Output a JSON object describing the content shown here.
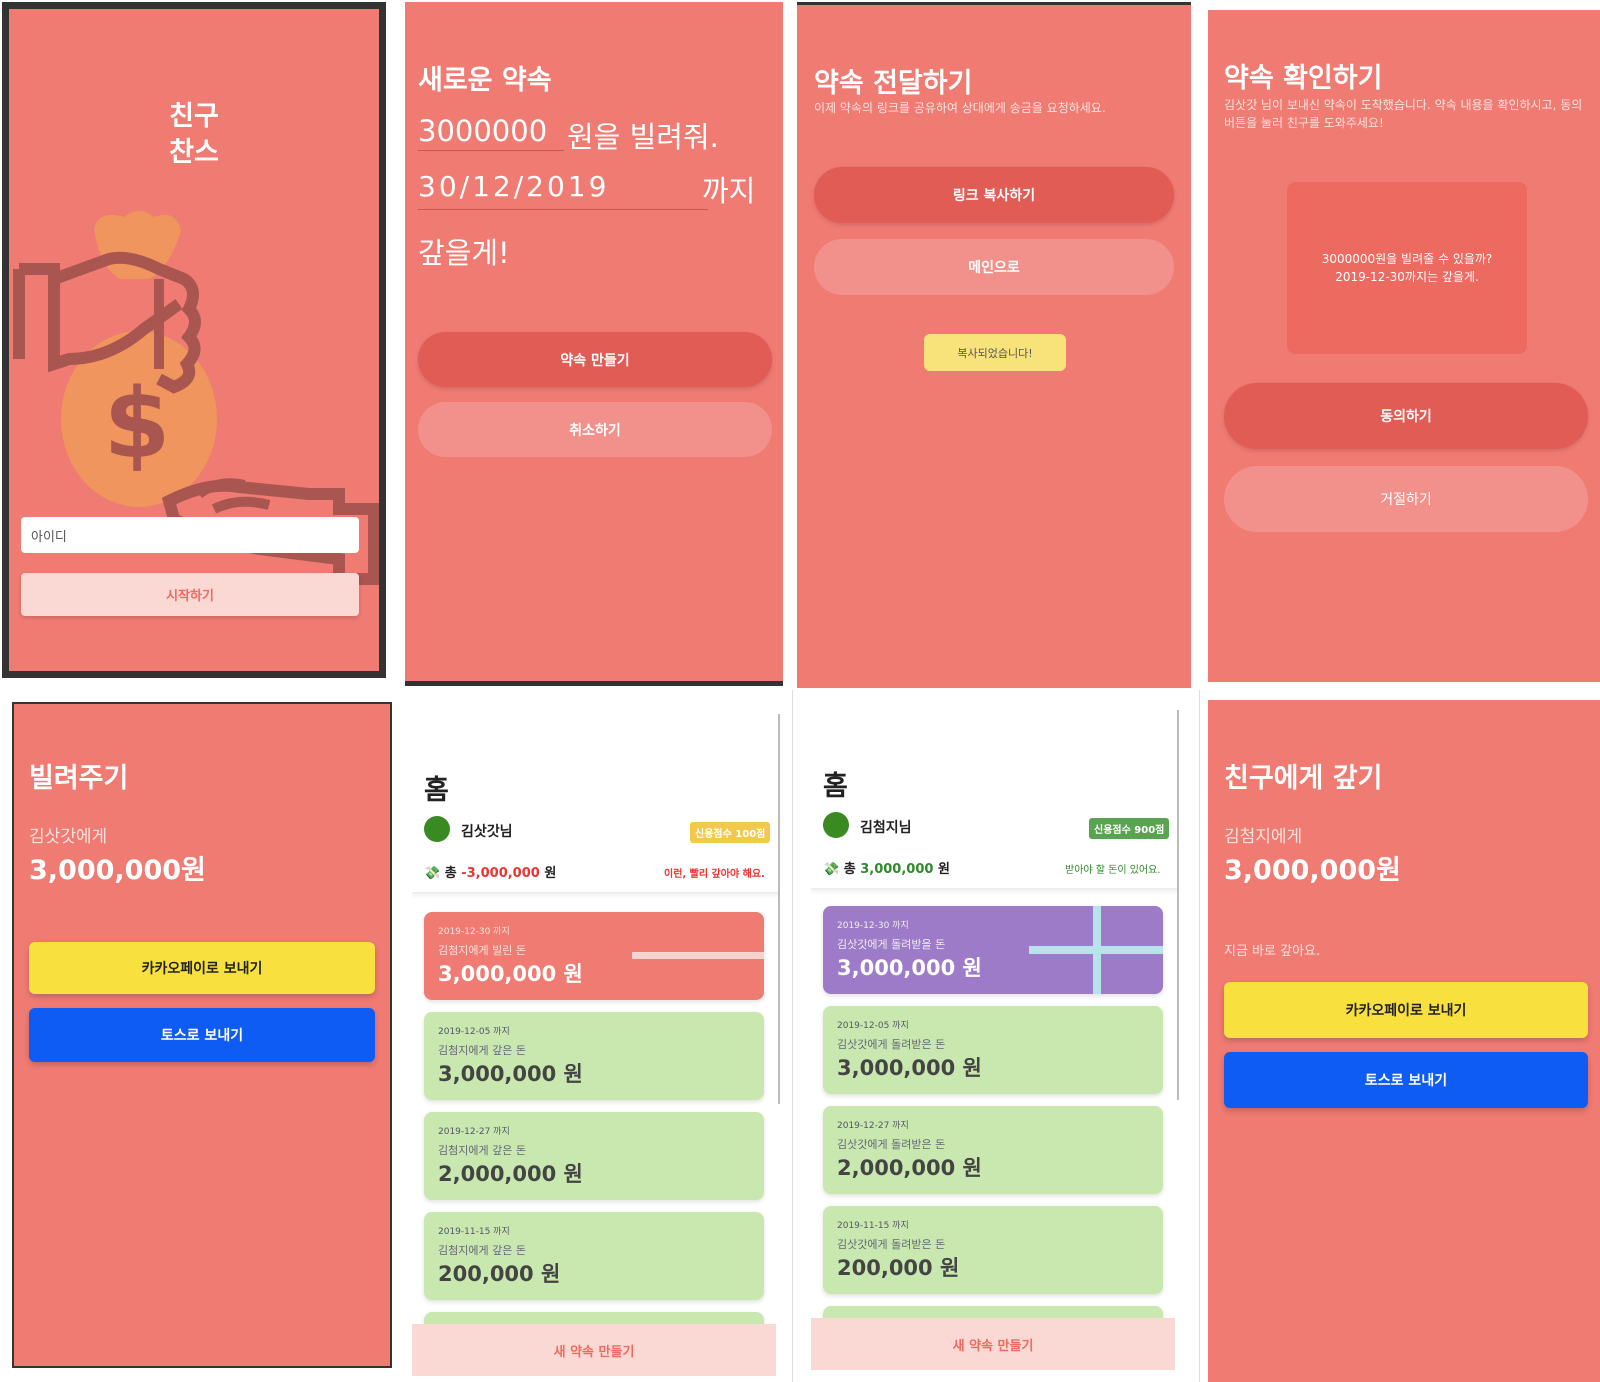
{
  "colors": {
    "coral": "#ef7b73",
    "primary_button": "#e05c55",
    "secondary_button": "#f2918b",
    "kakao": "#f8e13f",
    "toss": "#0f5cf5",
    "card_green": "#c8e8b0",
    "card_purple": "#9e7bc8"
  },
  "login": {
    "app_title_line1": "친구",
    "app_title_line2": "찬스",
    "illustration_icon": "money-bag-hand-icon",
    "id_placeholder": "아이디",
    "start_button": "시작하기"
  },
  "new_promise": {
    "title": "새로운 약속",
    "amount_value": "3000000",
    "amount_suffix": "원을 빌려줘.",
    "date_value": "30/12/2019",
    "date_suffix": "까지",
    "repay_text": "갚을게!",
    "make_button": "약속 만들기",
    "cancel_button": "취소하기"
  },
  "deliver": {
    "title": "약속 전달하기",
    "subtitle": "이제 약속의 링크를 공유하여 상대에게 송금을 요청하세요.",
    "copy_link_button": "링크 복사하기",
    "main_button": "메인으로",
    "copied_toast": "복사되었습니다!"
  },
  "confirm": {
    "title": "약속 확인하기",
    "subtitle": "김삿갓 님이 보내신 약속이 도착했습니다. 약속 내용을 확인하시고, 동의 버튼을 눌러 친구를 도와주세요!",
    "message_line1": "3000000원을 빌려줄 수 있을까?",
    "message_line2": "2019-12-30까지는 갚을게.",
    "agree_button": "동의하기",
    "reject_button": "거절하기"
  },
  "lend": {
    "title": "빌려주기",
    "recipient": "김삿갓에게",
    "amount": "3,000,000원",
    "kakao_button": "카카오페이로 보내기",
    "toss_button": "토스로 보내기"
  },
  "home_a": {
    "title": "홈",
    "user_name": "김삿갓님",
    "credit_badge": "신용점수 100점",
    "total_prefix": "총",
    "total_amount": "-3,000,000",
    "total_unit": "원",
    "status_note": "이런, 빨리 갚아야 해요.",
    "cards": [
      {
        "due": "2019-12-30 까지",
        "desc": "김첨지에게 빌린 돈",
        "amount": "3,000,000 원"
      },
      {
        "due": "2019-12-05 까지",
        "desc": "김첨지에게 갚은 돈",
        "amount": "3,000,000 원"
      },
      {
        "due": "2019-12-27 까지",
        "desc": "김첨지에게 갚은 돈",
        "amount": "2,000,000 원"
      },
      {
        "due": "2019-11-15 까지",
        "desc": "김첨지에게 갚은 돈",
        "amount": "200,000 원"
      }
    ],
    "new_promise_button": "새 약속 만들기"
  },
  "home_b": {
    "title": "홈",
    "user_name": "김첨지님",
    "credit_badge": "신용점수 900점",
    "total_prefix": "총",
    "total_amount": "3,000,000",
    "total_unit": "원",
    "status_note": "받아야 할 돈이 있어요.",
    "cards": [
      {
        "due": "2019-12-30 까지",
        "desc": "김삿갓에게 돌려받을 돈",
        "amount": "3,000,000 원"
      },
      {
        "due": "2019-12-05 까지",
        "desc": "김삿갓에게 돌려받은 돈",
        "amount": "3,000,000 원"
      },
      {
        "due": "2019-12-27 까지",
        "desc": "김삿갓에게 돌려받은 돈",
        "amount": "2,000,000 원"
      },
      {
        "due": "2019-11-15 까지",
        "desc": "김삿갓에게 돌려받은 돈",
        "amount": "200,000 원"
      }
    ],
    "new_promise_button": "새 약속 만들기"
  },
  "repay": {
    "title": "친구에게 갚기",
    "recipient": "김첨지에게",
    "amount": "3,000,000원",
    "pay_now": "지금 바로 갚아요.",
    "kakao_button": "카카오페이로 보내기",
    "toss_button": "토스로 보내기"
  }
}
